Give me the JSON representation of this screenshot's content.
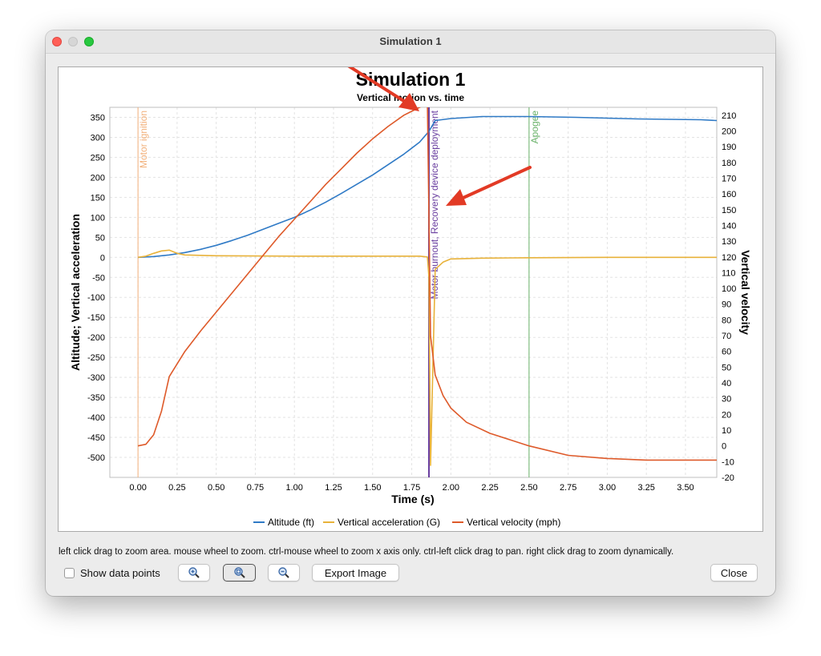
{
  "window": {
    "title": "Simulation 1"
  },
  "chart": {
    "title": "Simulation 1",
    "subtitle": "Vertical motion vs. time",
    "xlabel": "Time (s)",
    "ylabel_left": "Altitude; Vertical acceleration",
    "ylabel_right": "Vertical velocity",
    "x_ticks": [
      "0.00",
      "0.25",
      "0.50",
      "0.75",
      "1.00",
      "1.25",
      "1.50",
      "1.75",
      "2.00",
      "2.25",
      "2.50",
      "2.75",
      "3.00",
      "3.25",
      "3.50"
    ],
    "left_ticks": [
      "350",
      "300",
      "250",
      "200",
      "150",
      "100",
      "50",
      "0",
      "-50",
      "-100",
      "-150",
      "-200",
      "-250",
      "-300",
      "-350",
      "-400",
      "-450",
      "-500"
    ],
    "right_ticks": [
      "210",
      "200",
      "190",
      "180",
      "170",
      "160",
      "150",
      "140",
      "130",
      "120",
      "110",
      "100",
      "90",
      "80",
      "70",
      "60",
      "50",
      "40",
      "30",
      "20",
      "10",
      "0",
      "-10",
      "-20"
    ],
    "events": {
      "ignition": "Motor ignition",
      "burnout": "Motor burnout, Recovery device deployment",
      "apogee": "Apogee"
    },
    "legend": {
      "altitude": "Altitude (ft)",
      "acceleration": "Vertical acceleration (G)",
      "velocity": "Vertical velocity (mph)"
    }
  },
  "chart_data": {
    "type": "line",
    "title": "Simulation 1",
    "subtitle": "Vertical motion vs. time",
    "xlabel": "Time (s)",
    "ylabel": "Altitude; Vertical acceleration",
    "y2label": "Vertical velocity",
    "xlim": [
      -0.18,
      3.7
    ],
    "ylim": [
      -550,
      375
    ],
    "y2lim": [
      -20,
      215
    ],
    "grid": true,
    "legend": "bottom",
    "series": [
      {
        "name": "Altitude (ft)",
        "axis": "left",
        "color": "#2f7ac6",
        "x": [
          0.0,
          0.1,
          0.2,
          0.3,
          0.4,
          0.5,
          0.6,
          0.7,
          0.8,
          0.9,
          1.0,
          1.1,
          1.2,
          1.3,
          1.4,
          1.5,
          1.6,
          1.7,
          1.8,
          1.86,
          1.9,
          2.0,
          2.2,
          2.5,
          2.8,
          3.0,
          3.2,
          3.4,
          3.6,
          3.7
        ],
        "y": [
          0,
          2,
          6,
          12,
          20,
          30,
          42,
          55,
          70,
          85,
          100,
          118,
          138,
          160,
          183,
          206,
          232,
          258,
          288,
          315,
          342,
          347,
          352,
          352,
          350,
          348,
          346,
          345,
          344,
          342
        ]
      },
      {
        "name": "Vertical acceleration (G)",
        "axis": "left",
        "color": "#e8b23a",
        "x": [
          0.0,
          0.05,
          0.1,
          0.15,
          0.2,
          0.25,
          0.3,
          0.5,
          1.0,
          1.5,
          1.8,
          1.85,
          1.86,
          1.87,
          1.9,
          1.95,
          2.0,
          2.2,
          2.5,
          3.0,
          3.7
        ],
        "y": [
          0,
          3,
          10,
          16,
          18,
          10,
          6,
          4,
          3,
          3,
          3,
          1,
          -50,
          -520,
          -30,
          -12,
          -4,
          -2,
          -1,
          0,
          0
        ]
      },
      {
        "name": "Vertical velocity (mph)",
        "axis": "right",
        "color": "#de5a2a",
        "x": [
          0.0,
          0.05,
          0.1,
          0.15,
          0.2,
          0.3,
          0.4,
          0.5,
          0.6,
          0.7,
          0.8,
          0.9,
          1.0,
          1.1,
          1.2,
          1.3,
          1.4,
          1.5,
          1.6,
          1.7,
          1.8,
          1.85,
          1.87,
          1.9,
          1.95,
          2.0,
          2.1,
          2.25,
          2.5,
          2.75,
          3.0,
          3.25,
          3.5,
          3.7
        ],
        "y": [
          0,
          1,
          7,
          22,
          44,
          60,
          73,
          85,
          97,
          109,
          121,
          133,
          144,
          155,
          166,
          176,
          186,
          195,
          203,
          210,
          215,
          217,
          70,
          45,
          32,
          24,
          15,
          8,
          0,
          -6,
          -8,
          -9,
          -9,
          -9
        ]
      }
    ],
    "annotations": [
      {
        "label": "Motor ignition",
        "x": 0.0
      },
      {
        "label": "Motor burnout, Recovery device deployment",
        "x": 1.86
      },
      {
        "label": "Apogee",
        "x": 2.5
      }
    ]
  },
  "hint_text": "left click drag to zoom area. mouse wheel to zoom. ctrl-mouse wheel to zoom x axis only. ctrl-left click drag to pan.  right click drag to zoom dynamically.",
  "controls": {
    "show_data_points": "Show data points",
    "export_image": "Export Image",
    "close": "Close"
  }
}
